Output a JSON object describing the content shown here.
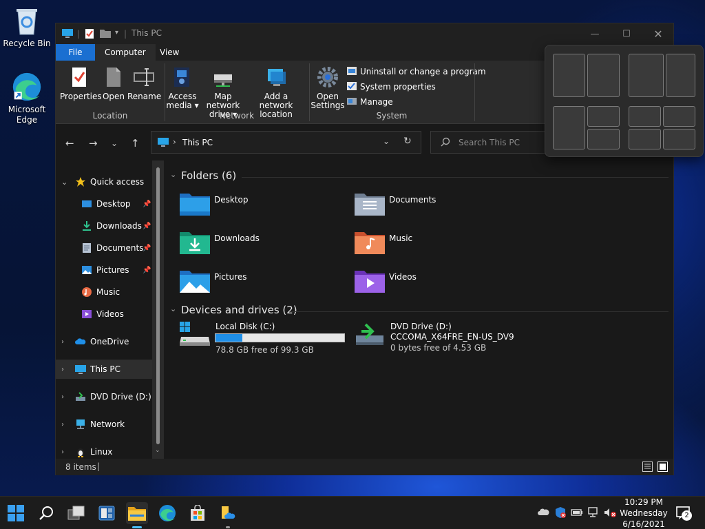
{
  "desktop": {
    "icons": [
      {
        "label": "Recycle Bin",
        "icon": "recycle-bin-icon"
      },
      {
        "label": "Microsoft Edge",
        "icon": "edge-icon"
      }
    ]
  },
  "window": {
    "title": "This PC",
    "controls": [
      "minimize",
      "maximize",
      "close"
    ]
  },
  "ribbon": {
    "tabs": [
      "File",
      "Computer",
      "View"
    ],
    "active_tab": "Computer",
    "file_tab_color": "#1a6fd1",
    "location": {
      "label": "Location",
      "buttons": [
        "Properties",
        "Open",
        "Rename"
      ]
    },
    "network": {
      "label": "Network",
      "buttons": [
        {
          "line1": "Access",
          "line2": "media ▾"
        },
        {
          "line1": "Map network",
          "line2": "drive ▾"
        },
        {
          "line1": "Add a network",
          "line2": "location"
        }
      ]
    },
    "system": {
      "label": "System",
      "open_settings": {
        "line1": "Open",
        "line2": "Settings"
      },
      "items": [
        "Uninstall or change a program",
        "System properties",
        "Manage"
      ]
    }
  },
  "navigation": {
    "address": "This PC",
    "search_placeholder": "Search This PC"
  },
  "sidebar": {
    "quick_access": "Quick access",
    "pinned": [
      "Desktop",
      "Downloads",
      "Documents",
      "Pictures"
    ],
    "others": [
      "Music",
      "Videos"
    ],
    "roots": [
      "OneDrive",
      "This PC",
      "DVD Drive (D:) CC",
      "Network",
      "Linux"
    ],
    "selected": "This PC"
  },
  "content": {
    "folders_header": "Folders (6)",
    "folders": [
      {
        "name": "Desktop",
        "icon": "desktop-folder-icon",
        "color": "#2d8fe0"
      },
      {
        "name": "Documents",
        "icon": "documents-folder-icon",
        "color": "#8c9bb0"
      },
      {
        "name": "Downloads",
        "icon": "downloads-folder-icon",
        "color": "#1fae8a"
      },
      {
        "name": "Music",
        "icon": "music-folder-icon",
        "color": "#e86a44"
      },
      {
        "name": "Pictures",
        "icon": "pictures-folder-icon",
        "color": "#2d8fe0"
      },
      {
        "name": "Videos",
        "icon": "videos-folder-icon",
        "color": "#8a4fd8"
      }
    ],
    "drives_header": "Devices and drives (2)",
    "drives": [
      {
        "name": "Local Disk (C:)",
        "free": "78.8 GB free of 99.3 GB",
        "used_fraction": 0.21
      },
      {
        "name": "DVD Drive (D:)",
        "label": "CCCOMA_X64FRE_EN-US_DV9",
        "free": "0 bytes free of 4.53 GB"
      }
    ]
  },
  "status": {
    "items": "8 items"
  },
  "taskbar": {
    "time": "10:29 PM",
    "day": "Wednesday",
    "date": "6/16/2021",
    "notifications": "2",
    "apps": [
      "start-icon",
      "search-icon",
      "task-view-icon",
      "widgets-icon",
      "file-explorer-icon",
      "edge-icon",
      "store-icon",
      "folder-cloud-icon"
    ]
  }
}
